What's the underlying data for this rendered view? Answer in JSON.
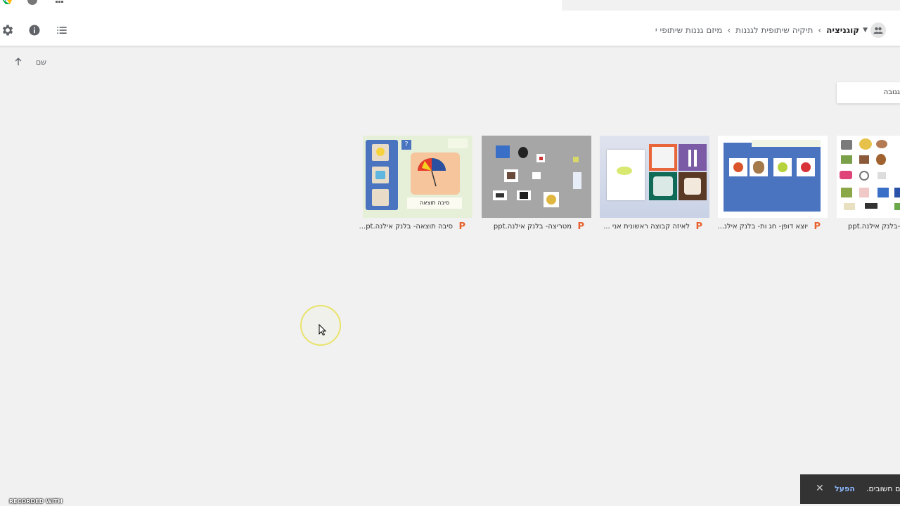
{
  "toolbar": {
    "breadcrumb": [
      "מיזם גננות שיתופי",
      "תיקיה שיתופית לגננות",
      "קוגניציה"
    ],
    "breadcrumb_prefix": "י"
  },
  "list_header": {
    "sort_label": "שם"
  },
  "side_panel": {
    "text": "גגובה"
  },
  "files": [
    {
      "name": "סיבה תוצאה- בלנק אילנה.pt...",
      "icon": "powerpoint-icon"
    },
    {
      "name": "מטריצה- בלנק אילנה.ppt",
      "icon": "powerpoint-icon"
    },
    {
      "name": "לאיזה קבוצה ראשונית אני ...",
      "icon": "powerpoint-icon"
    },
    {
      "name": "יוצא דופן- חג ות- בלנק אילנ...",
      "icon": "powerpoint-icon"
    },
    {
      "name": "תו-בלנק אילנה.ppt",
      "icon": "powerpoint-icon"
    }
  ],
  "thumbnail_text": {
    "cause_effect_title": "סיבה תוצאה"
  },
  "toast": {
    "text": "נם חשובים.",
    "action": "הפעל",
    "close": "✕"
  },
  "watermark": "RECORDED WITH",
  "colors": {
    "ppt": "#e8602c",
    "toast_bg": "#333333",
    "toast_action": "#8ab4f8"
  }
}
